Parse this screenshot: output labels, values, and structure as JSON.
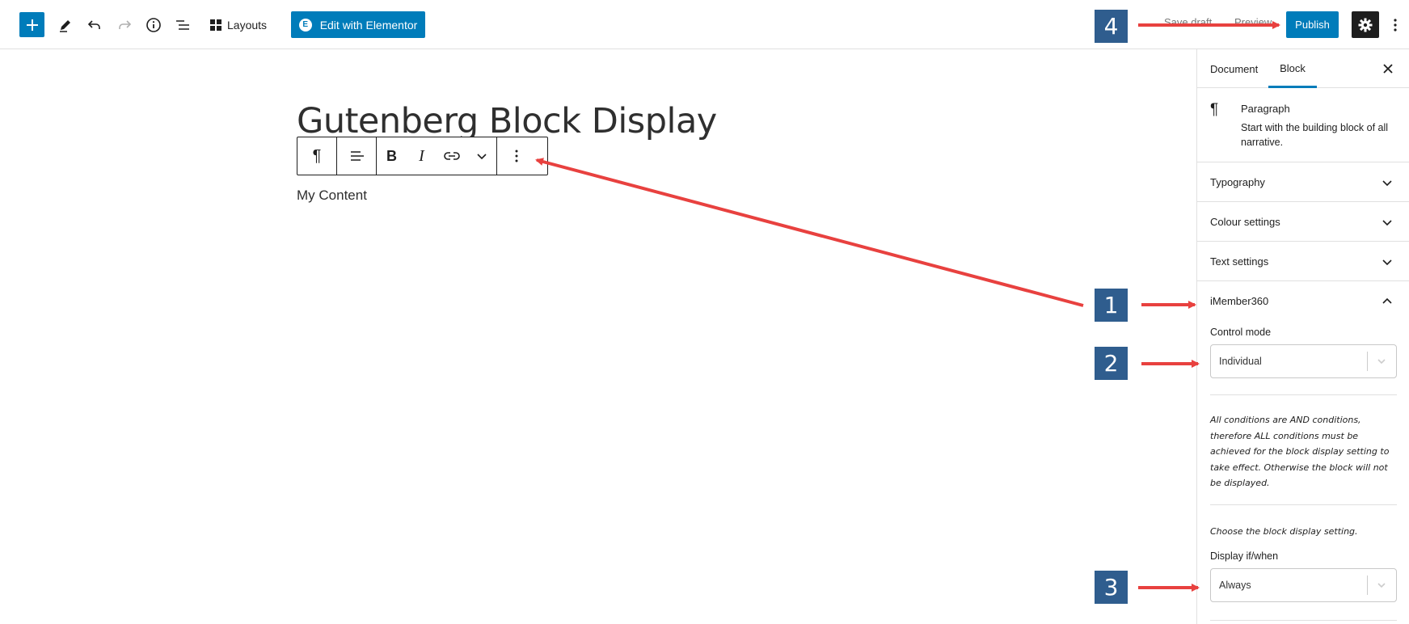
{
  "toolbar": {
    "layouts_label": "Layouts",
    "elementor_label": "Edit with Elementor",
    "elementor_icon_glyph": "E",
    "save_draft_label": "Save draft",
    "preview_label": "Preview",
    "publish_label": "Publish",
    "icons": [
      "plus-icon",
      "pencil-icon",
      "undo-icon",
      "redo-icon",
      "info-icon",
      "list-view-icon",
      "layouts-icon",
      "gear-icon",
      "more-vertical-icon"
    ]
  },
  "editor": {
    "title": "Gutenberg Block Display",
    "paragraph": "My Content",
    "block_toolbar": {
      "bold_glyph": "B",
      "italic_glyph": "I",
      "icons": [
        "paragraph-icon",
        "align-left-icon",
        "bold-icon",
        "italic-icon",
        "link-icon",
        "chevron-down-icon",
        "more-vertical-icon"
      ]
    }
  },
  "sidebar": {
    "tabs": [
      {
        "label": "Document",
        "active": false
      },
      {
        "label": "Block",
        "active": true
      }
    ],
    "block_card": {
      "title": "Paragraph",
      "description": "Start with the building block of all narrative."
    },
    "panels": [
      {
        "label": "Typography",
        "open": false
      },
      {
        "label": "Colour settings",
        "open": false
      },
      {
        "label": "Text settings",
        "open": false
      },
      {
        "label": "iMember360",
        "open": true
      }
    ],
    "imember": {
      "control_mode_label": "Control mode",
      "control_mode_value": "Individual",
      "note": "All conditions are AND conditions, therefore ALL conditions must be achieved for the block display setting to take effect. Otherwise the block will not be displayed.",
      "choose_label": "Choose the block display setting.",
      "display_label": "Display if/when",
      "display_value": "Always"
    }
  },
  "annotations": {
    "badges": [
      "1",
      "2",
      "3",
      "4"
    ],
    "arrow_color": "#e8413f",
    "badge_color": "#2f5d8e"
  },
  "colors": {
    "accent": "#007cba",
    "dark": "#1e1e1e",
    "border": "#e0e0e0"
  }
}
